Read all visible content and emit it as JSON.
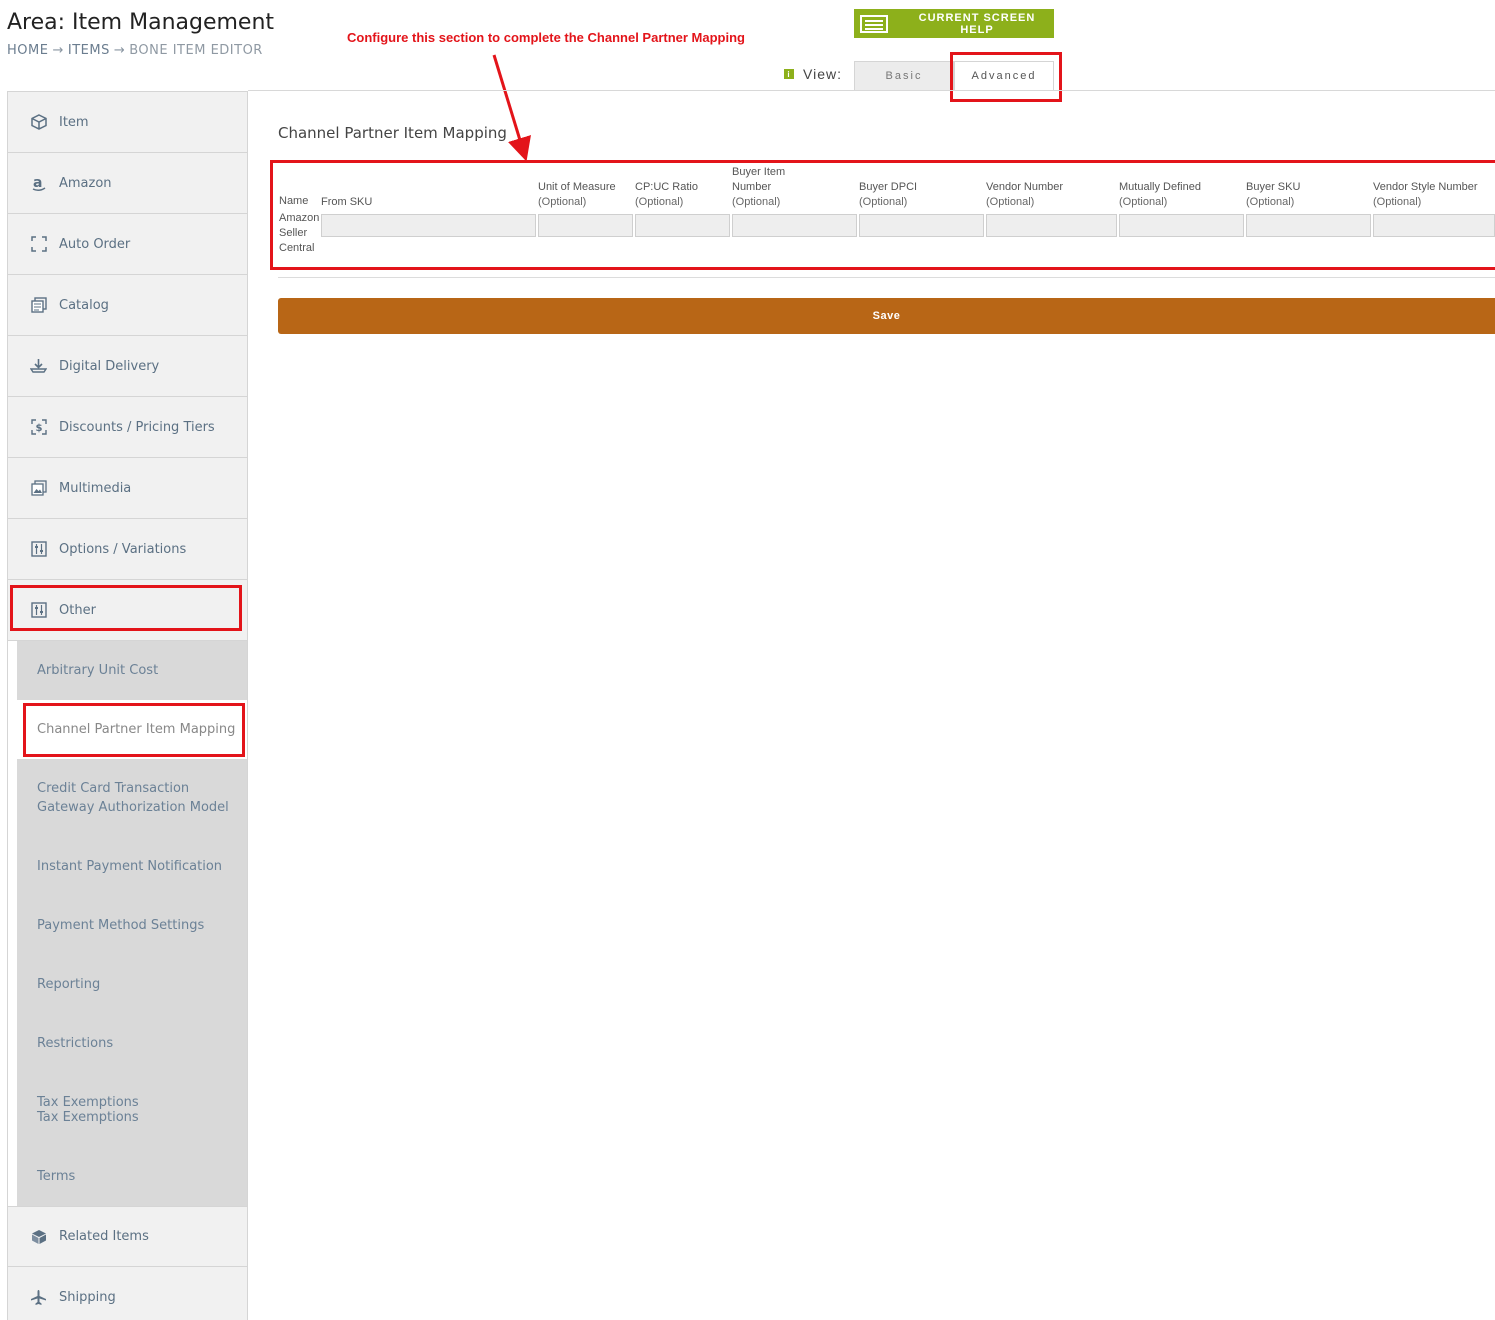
{
  "header": {
    "area_title": "Area: Item Management",
    "breadcrumb": [
      "HOME",
      "ITEMS",
      "BONE ITEM EDITOR"
    ],
    "breadcrumb_sep": "→",
    "help_button": "CURRENT SCREEN HELP",
    "annotation": "Configure this section to complete the Channel Partner Mapping"
  },
  "view": {
    "label": "View:",
    "info_glyph": "i",
    "tabs": [
      "Basic",
      "Advanced"
    ],
    "selected": "Advanced"
  },
  "sidebar": {
    "items_top": [
      {
        "label": "Item",
        "icon": "box-icon"
      },
      {
        "label": "Amazon",
        "icon": "amazon-icon"
      },
      {
        "label": "Auto Order",
        "icon": "frame-icon"
      },
      {
        "label": "Catalog",
        "icon": "catalog-icon"
      },
      {
        "label": "Digital Delivery",
        "icon": "download-icon"
      },
      {
        "label": "Discounts / Pricing Tiers",
        "icon": "dollar-icon"
      },
      {
        "label": "Multimedia",
        "icon": "image-icon"
      },
      {
        "label": "Options / Variations",
        "icon": "sliders-icon"
      },
      {
        "label": "Other",
        "icon": "sliders-icon"
      }
    ],
    "sub_items": [
      {
        "label": "Arbitrary Unit Cost"
      },
      {
        "label": "Channel Partner Item Mapping"
      },
      {
        "label": "Credit Card Transaction Gateway Authorization Model"
      },
      {
        "label": "Instant Payment Notification"
      },
      {
        "label": "Payment Method Settings"
      },
      {
        "label": "Reporting"
      },
      {
        "label": "Restrictions"
      },
      {
        "label": "Tax Exemptions",
        "label2": "Tax Exemptions"
      },
      {
        "label": "Terms"
      }
    ],
    "active_sub": "Channel Partner Item Mapping",
    "items_bottom": [
      {
        "label": "Related Items",
        "icon": "cube-icon"
      },
      {
        "label": "Shipping",
        "icon": "plane-icon"
      }
    ]
  },
  "main": {
    "section_title": "Channel Partner Item Mapping",
    "name_header": "Name",
    "columns": [
      {
        "line1": "From SKU",
        "line2": ""
      },
      {
        "line1": "Unit of Measure",
        "line2": "(Optional)"
      },
      {
        "line1": "CP:UC Ratio",
        "line2": "(Optional)"
      },
      {
        "line0": "Buyer Item",
        "line1": "Number",
        "line2": "(Optional)"
      },
      {
        "line1": "Buyer DPCI",
        "line2": "(Optional)"
      },
      {
        "line1": "Vendor Number",
        "line2": "(Optional)"
      },
      {
        "line1": "Mutually Defined",
        "line2": "(Optional)"
      },
      {
        "line1": "Buyer SKU",
        "line2": "(Optional)"
      },
      {
        "line1": "Vendor Style Number",
        "line2": "(Optional)"
      }
    ],
    "row_name": [
      "Amazon",
      "Seller",
      "Central"
    ],
    "row_values": [
      "",
      "",
      "",
      "",
      "",
      "",
      "",
      "",
      ""
    ],
    "save_label": "Save"
  },
  "colors": {
    "accent_green": "#8db01b",
    "save_brown": "#b86616",
    "annotation_red": "#e3141a",
    "nav_text": "#5b7083"
  }
}
